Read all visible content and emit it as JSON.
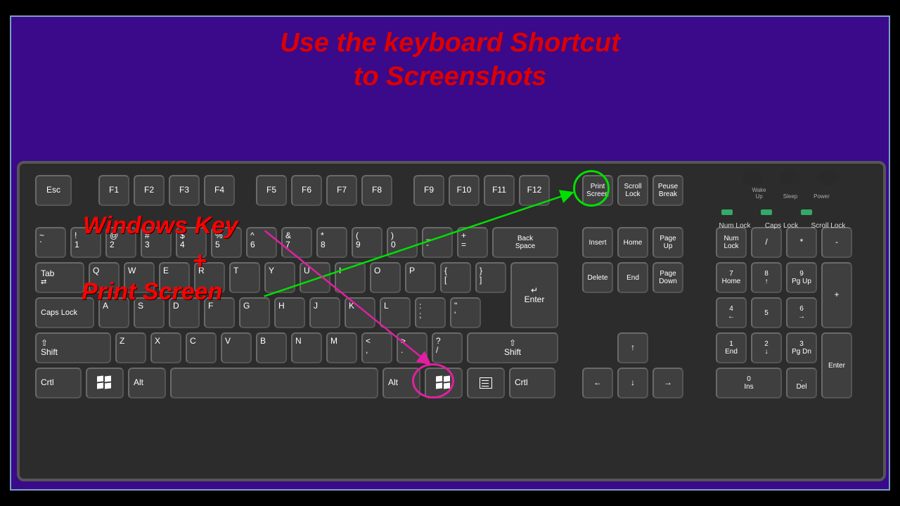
{
  "title_line1": "Use the keyboard Shortcut",
  "title_line2": "to Screenshots",
  "annot_win": "Windows Key",
  "annot_plus": "+",
  "annot_ps": "Print Screen",
  "f": {
    "esc": "Esc",
    "f1": "F1",
    "f2": "F2",
    "f3": "F3",
    "f4": "F4",
    "f5": "F5",
    "f6": "F6",
    "f7": "F7",
    "f8": "F8",
    "f9": "F9",
    "f10": "F10",
    "f11": "F11",
    "f12": "F12",
    "print": "Print\nScreen",
    "scroll": "Scroll\nLock",
    "pause": "Peuse\nBreak"
  },
  "r1": {
    "tilde_top": "~",
    "tilde_bot": "`",
    "k1_top": "!",
    "k1_bot": "1",
    "k2_top": "@",
    "k2_bot": "2",
    "k3_top": "#",
    "k3_bot": "3",
    "k4_top": "$",
    "k4_bot": "4",
    "k5_top": "%",
    "k5_bot": "5",
    "k6_top": "^",
    "k6_bot": "6",
    "k7_top": "&",
    "k7_bot": "7",
    "k8_top": "*",
    "k8_bot": "8",
    "k9_top": "(",
    "k9_bot": "9",
    "k0_top": ")",
    "k0_bot": "0",
    "min_top": "_",
    "min_bot": "-",
    "eq_top": "+",
    "eq_bot": "=",
    "back": "Back\nSpace"
  },
  "r2": {
    "tab": "Tab",
    "q": "Q",
    "w": "W",
    "e": "E",
    "r": "R",
    "t": "T",
    "y": "Y",
    "u": "U",
    "i": "I",
    "o": "O",
    "p": "P",
    "lb_top": "{",
    "lb_bot": "[",
    "rb_top": "}",
    "rb_bot": "]",
    "enter": "Enter"
  },
  "r3": {
    "caps": "Caps Lock",
    "a": "A",
    "s": "S",
    "d": "D",
    "f": "F",
    "g": "G",
    "h": "H",
    "j": "J",
    "k": "K",
    "l": "L",
    "semi_top": ":",
    "semi_bot": ";",
    "quote_top": "\"",
    "quote_bot": "'",
    "enter": "Enter"
  },
  "r4": {
    "lshift": "Shift",
    "z": "Z",
    "x": "X",
    "c": "C",
    "v": "V",
    "b": "B",
    "n": "N",
    "m": "M",
    "comma_top": "<",
    "comma_bot": ",",
    "dot_top": ">",
    "dot_bot": ".",
    "slash_top": "?",
    "slash_bot": "/",
    "rshift": "Shift"
  },
  "r5": {
    "lctrl": "Crtl",
    "lalt": "Alt",
    "ralt": "Alt",
    "rctrl": "Crtl"
  },
  "nav": {
    "ins": "Insert",
    "home": "Home",
    "pgup": "Page\nUp",
    "del": "Delete",
    "end": "End",
    "pgdn": "Page\nDown"
  },
  "arrow": {
    "up": "↑",
    "left": "←",
    "down": "↓",
    "right": "→"
  },
  "num": {
    "numlock": "Num\nLock",
    "div": "/",
    "mul": "*",
    "sub": "-",
    "k7": "7\nHome",
    "k8": "8\n↑",
    "k9": "9\nPg Up",
    "add": "+",
    "k4": "4\n←",
    "k5": "5",
    "k6": "6\n→",
    "k1": "1\nEnd",
    "k2": "2\n↓",
    "k3": "3\nPg Dn",
    "enter": "Enter",
    "k0": "0\nIns",
    "dot": ".\nDel"
  },
  "ind": {
    "numlock": "Num Lock",
    "capslock": "Caps Lock",
    "scrolllock": "Scroll Lock",
    "wake": "Wake\nUp",
    "sleep": "Sleep",
    "power": "Power"
  }
}
